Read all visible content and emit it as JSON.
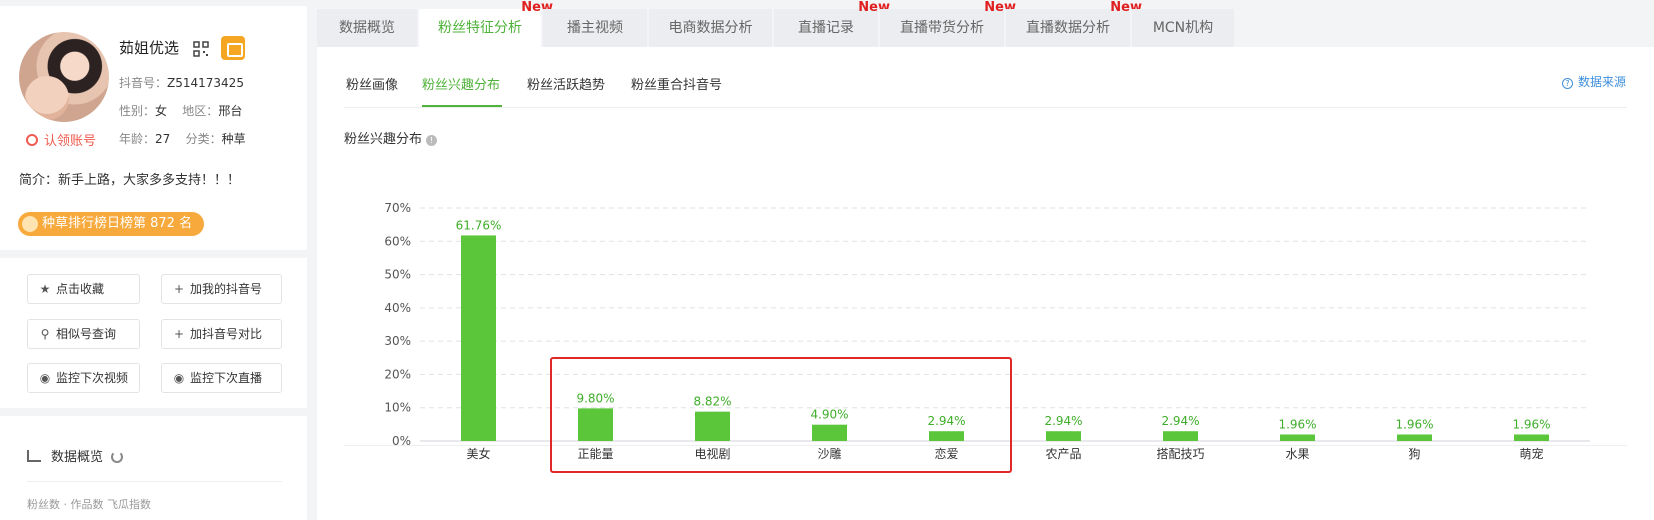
{
  "profile": {
    "name": "茹姐优选",
    "douyin_id_label": "抖音号：",
    "douyin_id": "Z514173425",
    "gender_label": "性别：",
    "gender": "女",
    "region_label": "地区：",
    "region": "邢台",
    "age_label": "年龄：",
    "age": "27",
    "category_label": "分类：",
    "category": "种草",
    "verify_text": "认领账号",
    "bio": "简介：新手上路，大家多多支持！！！",
    "rank_text": "种草排行榜日榜第 872 名"
  },
  "actions": [
    {
      "label": "点击收藏",
      "icon": "star-icon"
    },
    {
      "label": "加我的抖音号",
      "icon": "plus-icon"
    },
    {
      "label": "相似号查询",
      "icon": "search-icon"
    },
    {
      "label": "加抖音号对比",
      "icon": "plus-icon"
    },
    {
      "label": "监控下次视频",
      "icon": "eye-icon"
    },
    {
      "label": "监控下次直播",
      "icon": "eye-icon"
    }
  ],
  "overview": {
    "title": "数据概览",
    "cut_text": "粉丝数 ·        作品数    飞瓜指数"
  },
  "tabs": [
    {
      "label": "数据概览",
      "new": ""
    },
    {
      "label": "粉丝特征分析",
      "new": "New"
    },
    {
      "label": "播主视频",
      "new": ""
    },
    {
      "label": "电商数据分析",
      "new": ""
    },
    {
      "label": "直播记录",
      "new": "New"
    },
    {
      "label": "直播带货分析",
      "new": "New"
    },
    {
      "label": "直播数据分析",
      "new": "New"
    },
    {
      "label": "MCN机构",
      "new": ""
    }
  ],
  "active_tab": "粉丝特征分析",
  "subtabs": [
    "粉丝画像",
    "粉丝兴趣分布",
    "粉丝活跃趋势",
    "粉丝重合抖音号"
  ],
  "active_subtab": "粉丝兴趣分布",
  "data_source": "数据来源",
  "chart_title": "粉丝兴趣分布",
  "colors": {
    "accent": "#4fb23a",
    "bar": "#5cc63a",
    "new_badge": "#e02020",
    "highlight": "#e02828"
  },
  "chart_data": {
    "type": "bar",
    "categories": [
      "美女",
      "正能量",
      "电视剧",
      "沙雕",
      "恋爱",
      "农产品",
      "搭配技巧",
      "水果",
      "狗",
      "萌宠"
    ],
    "values": [
      61.76,
      9.8,
      8.82,
      4.9,
      2.94,
      2.94,
      2.94,
      1.96,
      1.96,
      1.96
    ],
    "value_labels": [
      "61.76%",
      "9.80%",
      "8.82%",
      "4.90%",
      "2.94%",
      "2.94%",
      "2.94%",
      "1.96%",
      "1.96%",
      "1.96%"
    ],
    "yticks": [
      "0%",
      "10%",
      "20%",
      "30%",
      "40%",
      "50%",
      "60%",
      "70%"
    ],
    "ylim": [
      0,
      70
    ],
    "grid": true,
    "highlighted_categories": [
      "正能量",
      "电视剧",
      "沙雕",
      "恋爱"
    ]
  }
}
